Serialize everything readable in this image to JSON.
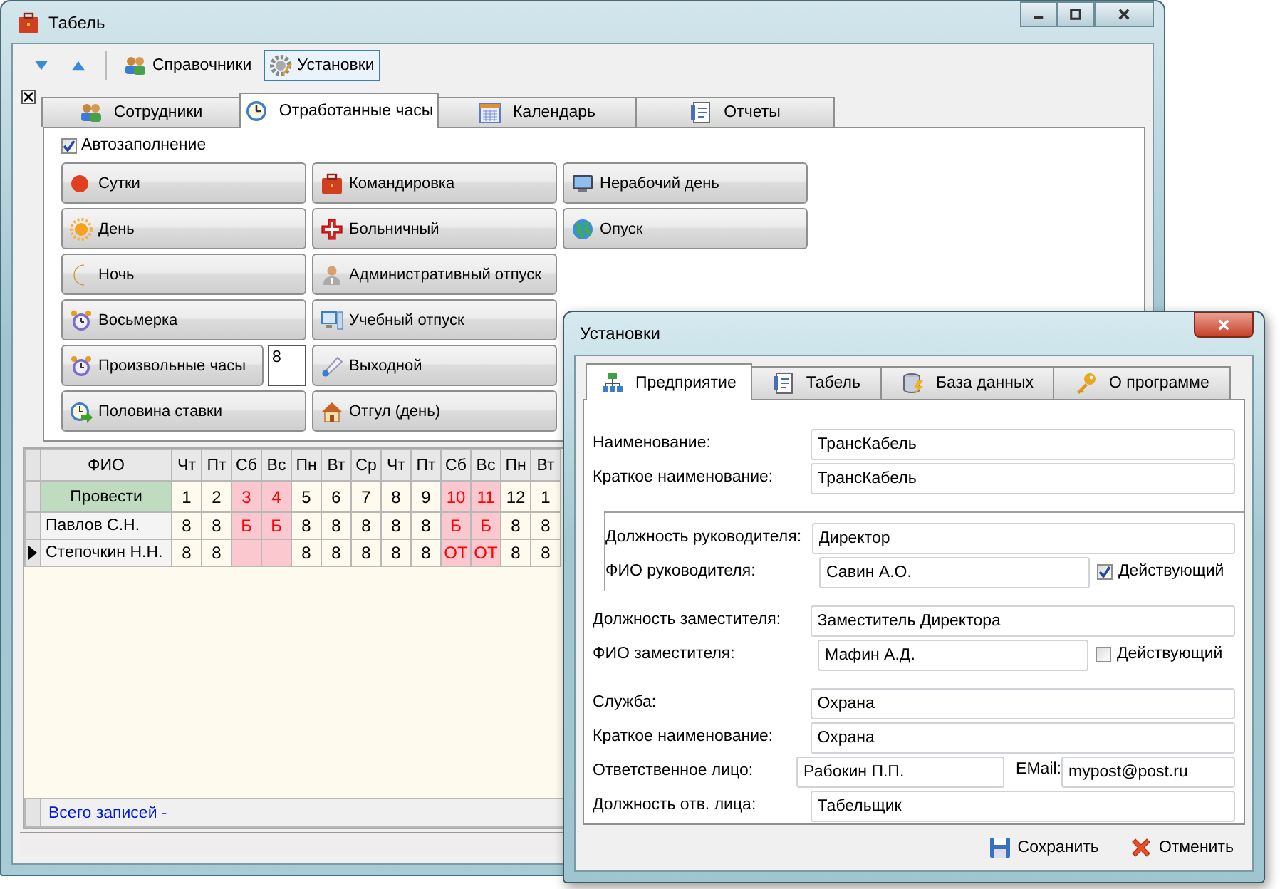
{
  "main_window": {
    "title": "Табель",
    "toolbar": [
      {
        "label": "Справочники",
        "selected": false
      },
      {
        "label": "Установки",
        "selected": true
      }
    ],
    "tabs": [
      {
        "label": "Сотрудники",
        "selected": false
      },
      {
        "label": "Отработанные часы",
        "selected": true
      },
      {
        "label": "Календарь",
        "selected": false
      },
      {
        "label": "Отчеты",
        "selected": false
      }
    ],
    "autofill": {
      "label": "Автозаполнение",
      "checked": true
    },
    "button_columns": [
      [
        {
          "label": "Сутки"
        },
        {
          "label": "День"
        },
        {
          "label": "Ночь"
        },
        {
          "label": "Восьмерка"
        },
        {
          "label": "Произвольные часы",
          "hours": "8"
        },
        {
          "label": "Половина ставки"
        }
      ],
      [
        {
          "label": "Командировка"
        },
        {
          "label": "Больничный"
        },
        {
          "label": "Административный отпуск"
        },
        {
          "label": "Учебный отпуск"
        },
        {
          "label": "Выходной"
        },
        {
          "label": "Отгул (день)"
        }
      ],
      [
        {
          "label": "Нерабочий день"
        },
        {
          "label": "Опуск"
        }
      ]
    ],
    "grid": {
      "name_header": "ФИО",
      "action": "Провести",
      "columns": [
        {
          "day": "Чт",
          "date": "1",
          "weekend": false
        },
        {
          "day": "Пт",
          "date": "2",
          "weekend": false
        },
        {
          "day": "Сб",
          "date": "3",
          "weekend": true
        },
        {
          "day": "Вс",
          "date": "4",
          "weekend": true
        },
        {
          "day": "Пн",
          "date": "5",
          "weekend": false
        },
        {
          "day": "Вт",
          "date": "6",
          "weekend": false
        },
        {
          "day": "Ср",
          "date": "7",
          "weekend": false
        },
        {
          "day": "Чт",
          "date": "8",
          "weekend": false
        },
        {
          "day": "Пт",
          "date": "9",
          "weekend": false
        },
        {
          "day": "Сб",
          "date": "10",
          "weekend": true
        },
        {
          "day": "Вс",
          "date": "11",
          "weekend": true
        },
        {
          "day": "Пн",
          "date": "12",
          "weekend": false
        },
        {
          "day": "Вт",
          "date": "1",
          "weekend": false
        }
      ],
      "rows": [
        {
          "name": "Павлов С.Н.",
          "current": false,
          "cells": [
            "8",
            "8",
            "Б",
            "Б",
            "8",
            "8",
            "8",
            "8",
            "8",
            "Б",
            "Б",
            "8",
            "8"
          ]
        },
        {
          "name": "Степочкин Н.Н.",
          "current": true,
          "cells": [
            "8",
            "8",
            "",
            "",
            "8",
            "8",
            "8",
            "8",
            "8",
            "ОТ",
            "ОТ",
            "8",
            "8"
          ]
        }
      ]
    },
    "footer": "Всего записей -"
  },
  "dialog": {
    "title": "Установки",
    "tabs": [
      {
        "label": "Предприятие",
        "selected": true
      },
      {
        "label": "Табель",
        "selected": false
      },
      {
        "label": "База данных",
        "selected": false
      },
      {
        "label": "О программе",
        "selected": false
      }
    ],
    "sections": [
      {
        "framed": false,
        "fields": [
          {
            "label": "Наименование:",
            "value": "ТрансКабель"
          },
          {
            "label": "Краткое наименование:",
            "value": "ТрансКабель"
          }
        ]
      },
      {
        "framed": true,
        "fields": [
          {
            "label": "Должность руководителя:",
            "value": "Директор"
          },
          {
            "label": "ФИО руководителя:",
            "value": "Савин А.О.",
            "check": {
              "label": "Действующий",
              "checked": true
            }
          }
        ]
      },
      {
        "framed": false,
        "fields": [
          {
            "label": "Должность заместителя:",
            "value": "Заместитель Директора"
          },
          {
            "label": "ФИО заместителя:",
            "value": "Мафин А.Д.",
            "check": {
              "label": "Действующий",
              "checked": false
            }
          }
        ]
      },
      {
        "framed": false,
        "fields": [
          {
            "label": "Служба:",
            "value": "Охрана"
          },
          {
            "label": "Краткое наименование:",
            "value": "Охрана"
          },
          {
            "label": "Ответственное лицо:",
            "value": "Рабокин П.П.",
            "email": {
              "label": "EMail:",
              "value": "mypost@post.ru"
            }
          },
          {
            "label": "Должность отв. лица:",
            "value": "Табельщик"
          }
        ]
      }
    ],
    "buttons": [
      "Сохранить",
      "Отменить"
    ]
  }
}
